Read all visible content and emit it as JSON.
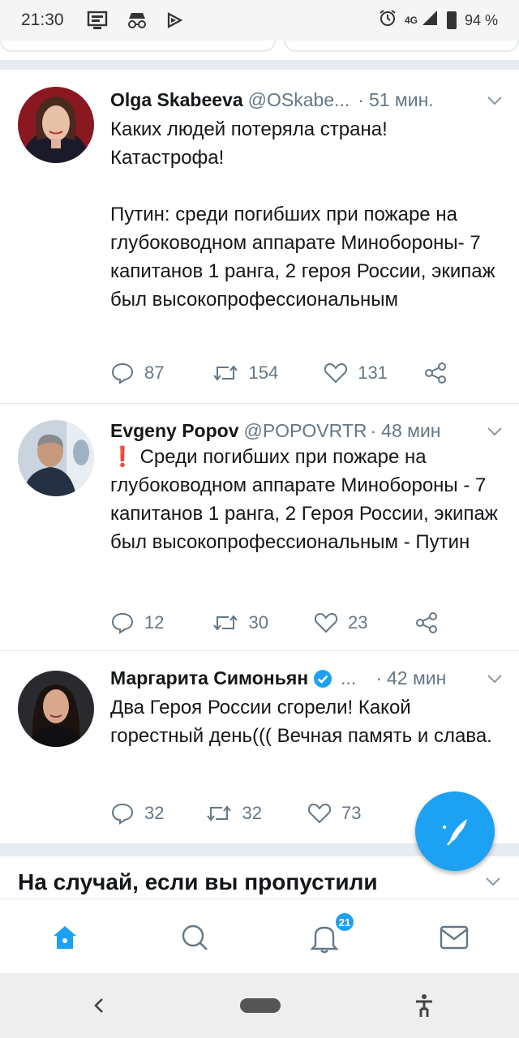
{
  "status_bar": {
    "time": "21:30",
    "network": "4G",
    "battery": "94 %",
    "icons": [
      "screenshot-icon",
      "incognito-icon",
      "cast-icon",
      "alarm-icon",
      "signal-icon",
      "battery-icon"
    ]
  },
  "tweets": [
    {
      "name": "Olga Skabeeva",
      "handle": "@OSkabe...",
      "time": "51 мин.",
      "verified": false,
      "text": "Каких людей потеряла страна!\nКатастрофа!\n\nПутин: среди погибших при пожаре на глубоководном аппарате Минобороны- 7 капитанов 1 ранга, 2 героя России, экипаж был высокопрофессиональным",
      "replies": "87",
      "retweets": "154",
      "likes": "131"
    },
    {
      "name": "Evgeny Popov",
      "handle": "@POPOVRTR",
      "time": "48 мин",
      "verified": false,
      "exclamation": "❗",
      "text": "Среди погибших при пожаре на глубоководном аппарате Минобороны - 7 капитанов 1 ранга, 2 Героя России, экипаж был высокопрофессиональным - Путин",
      "replies": "12",
      "retweets": "30",
      "likes": "23"
    },
    {
      "name": "Маргарита Симоньян",
      "handle": "...",
      "time": "42 мин",
      "verified": true,
      "text": "Два Героя России сгорели! Какой горестный день((( Вечная память и слава.",
      "replies": "32",
      "retweets": "32",
      "likes": "73"
    }
  ],
  "section": {
    "title": "На случай, если вы пропустили"
  },
  "tab_bar": {
    "tabs": [
      "home",
      "search",
      "notifications",
      "messages"
    ],
    "active": "home",
    "notification_badge": "21"
  },
  "colors": {
    "accent": "#1da1f2",
    "text": "#14171a",
    "secondary": "#657786",
    "separator": "#e6ecf0"
  }
}
